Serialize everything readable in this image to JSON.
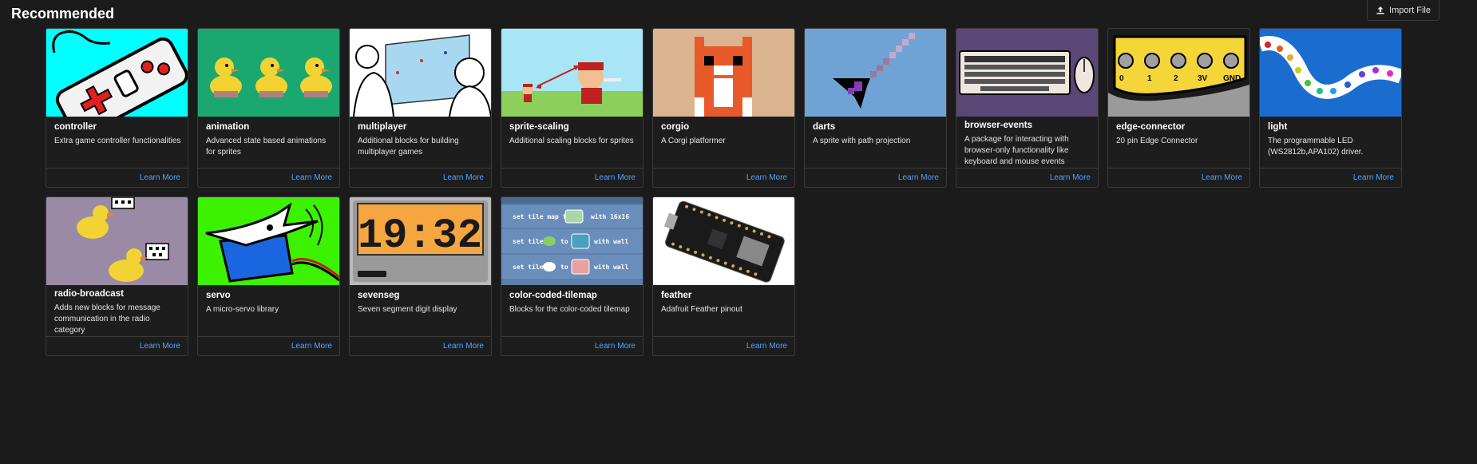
{
  "page": {
    "title": "Recommended"
  },
  "import_button": {
    "label": "Import File",
    "icon": "upload-icon"
  },
  "learn_more_label": "Learn More",
  "extensions": [
    {
      "name": "controller",
      "description": "Extra game controller functionalities"
    },
    {
      "name": "animation",
      "description": "Advanced state based animations for sprites"
    },
    {
      "name": "multiplayer",
      "description": "Additional blocks for building multiplayer games"
    },
    {
      "name": "sprite-scaling",
      "description": "Additional scaling blocks for sprites"
    },
    {
      "name": "corgio",
      "description": "A Corgi platformer"
    },
    {
      "name": "darts",
      "description": "A sprite with path projection"
    },
    {
      "name": "browser-events",
      "description": "A package for interacting with browser-only functionality like keyboard and mouse events"
    },
    {
      "name": "edge-connector",
      "description": "20 pin Edge Connector"
    },
    {
      "name": "light",
      "description": "The programmable LED (WS2812b,APA102) driver."
    },
    {
      "name": "radio-broadcast",
      "description": "Adds new blocks for message communication in the radio category"
    },
    {
      "name": "servo",
      "description": "A micro-servo library"
    },
    {
      "name": "sevenseg",
      "description": "Seven segment digit display"
    },
    {
      "name": "color-coded-tilemap",
      "description": "Blocks for the color-coded tilemap"
    },
    {
      "name": "feather",
      "description": "Adafruit Feather pinout"
    }
  ],
  "thumbnails": {
    "sevenseg_display": "19:32",
    "edge_connector_labels": [
      "0",
      "1",
      "2",
      "3V",
      "GND"
    ],
    "tilemap_blocks": [
      "set tile map to",
      "with 16x16",
      "set tile",
      "to",
      "with wall",
      "set tile",
      "to",
      "with wall"
    ]
  },
  "colors": {
    "background": "#1b1b1c",
    "link": "#4fa3ff",
    "card_border": "#3b3b3b"
  }
}
